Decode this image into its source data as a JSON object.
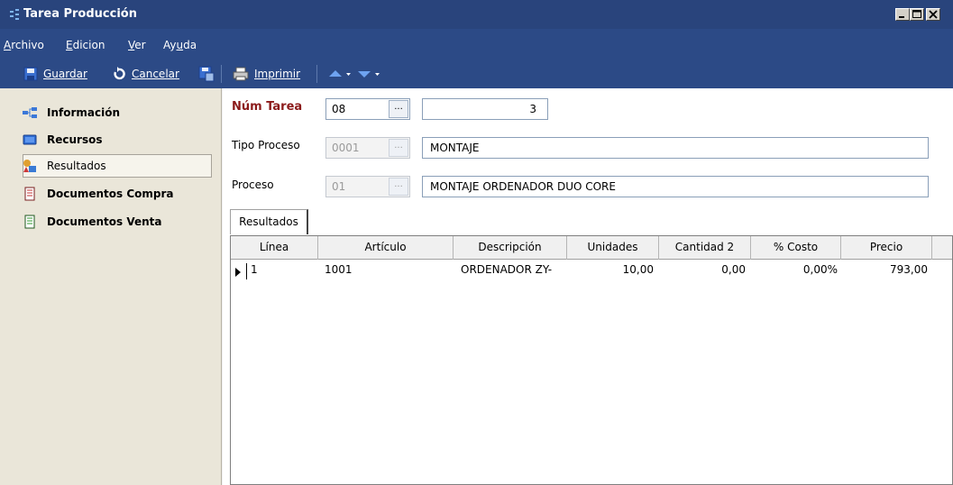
{
  "window": {
    "title": "Tarea Producción"
  },
  "menu": [
    {
      "label": "Archivo",
      "key": "A",
      "rest": "rchivo"
    },
    {
      "label": "Edicion",
      "key": "E",
      "rest": "dicion"
    },
    {
      "label": "Ver",
      "key": "V",
      "rest": "er"
    },
    {
      "label": "Ayuda",
      "pre": "Ay",
      "key": "u",
      "rest": "da"
    }
  ],
  "toolbar": {
    "guardar": "Guardar",
    "cancelar": "Cancelar",
    "imprimir": "Imprimir"
  },
  "sidebar": {
    "items": [
      {
        "label": "Información",
        "icon": "network-icon"
      },
      {
        "label": "Recursos",
        "icon": "monitor-icon"
      },
      {
        "label": "Resultados",
        "icon": "shapes-icon"
      },
      {
        "label": "Documentos Compra",
        "icon": "document-red-icon"
      },
      {
        "label": "Documentos Venta",
        "icon": "document-green-icon"
      }
    ]
  },
  "form": {
    "num_tarea": {
      "label": "Núm Tarea",
      "code": "08",
      "value": "3"
    },
    "tipo_proceso": {
      "label": "Tipo Proceso",
      "code": "0001",
      "value": "MONTAJE"
    },
    "proceso": {
      "label": "Proceso",
      "code": "01",
      "value": "MONTAJE ORDENADOR DUO CORE"
    },
    "browse_label": "..."
  },
  "tab": {
    "label": "Resultados"
  },
  "grid": {
    "columns": [
      "Línea",
      "Artículo",
      "Descripción",
      "Unidades",
      "Cantidad 2",
      "% Costo",
      "Precio"
    ],
    "rows": [
      {
        "linea": "1",
        "articulo": "1001",
        "descripcion": "ORDENADOR ZY-",
        "unidades": "10,00",
        "cantidad2": "0,00",
        "costo": "0,00%",
        "precio": "793,00"
      }
    ]
  },
  "colors": {
    "titlebar": "#29447c",
    "menubar": "#2c4a86",
    "sidebar": "#eae6d9",
    "required_label": "#8b1a1a"
  }
}
